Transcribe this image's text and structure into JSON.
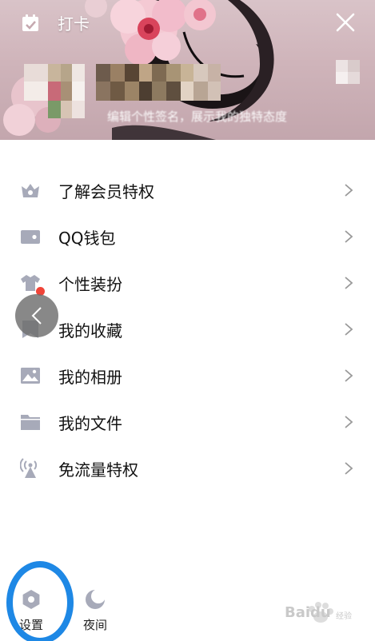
{
  "header": {
    "checkin_label": "打卡",
    "checkin_icon": "calendar-check-icon",
    "close_icon": "close-icon",
    "signature_text": "编辑个性签名，展示我的独特态度"
  },
  "menu": {
    "items": [
      {
        "label": "了解会员特权",
        "icon": "crown-icon"
      },
      {
        "label": "QQ钱包",
        "icon": "wallet-icon"
      },
      {
        "label": "个性装扮",
        "icon": "shirt-icon"
      },
      {
        "label": "我的收藏",
        "icon": "bookmark-icon"
      },
      {
        "label": "我的相册",
        "icon": "photo-icon"
      },
      {
        "label": "我的文件",
        "icon": "folder-icon"
      },
      {
        "label": "免流量特权",
        "icon": "signal-tower-icon"
      }
    ],
    "chevron_icon": "chevron-right-icon"
  },
  "bottom": {
    "settings_label": "设置",
    "settings_icon": "gear-icon",
    "night_label": "夜间",
    "night_icon": "moon-icon"
  },
  "float_back_icon": "chevron-left-icon",
  "watermark": {
    "text": "Baidu",
    "sub": "经验"
  },
  "colors": {
    "icon_gray": "#a7aab9",
    "highlight_ring": "#1e88e5",
    "badge_red": "#f04438",
    "text": "#111111"
  }
}
